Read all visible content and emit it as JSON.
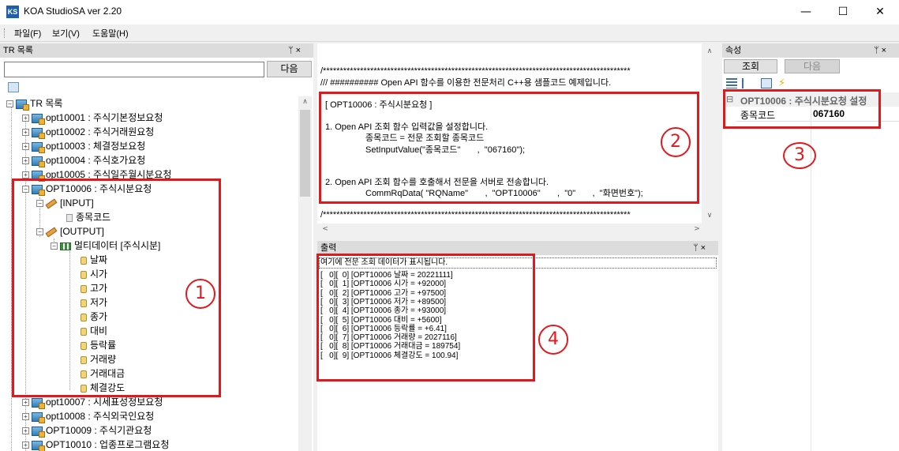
{
  "window": {
    "title": "KOA StudioSA ver 2.20",
    "icon_text": "KS",
    "minimize": "—",
    "maximize": "☐",
    "close": "✕"
  },
  "menu": [
    {
      "label": "파일(F)"
    },
    {
      "label": "보기(V)"
    },
    {
      "label": "도움말(H)"
    }
  ],
  "tr_panel": {
    "title": "TR 목록",
    "pin": "ᛘ ×",
    "search_value": "",
    "next_button": "다음",
    "root_label": "TR 목록",
    "items_top": [
      "opt10001 : 주식기본정보요청",
      "opt10002 : 주식거래원요청",
      "opt10003 : 체결정보요청",
      "opt10004 : 주식호가요청",
      "opt10005 : 주식일주월시분요청"
    ],
    "expanded": {
      "label": "OPT10006 : 주식시분요청",
      "input_label": "[INPUT]",
      "input_field": "종목코드",
      "output_label": "[OUTPUT]",
      "multi_label": "멀티데이터 [주식시분]",
      "fields": [
        "날짜",
        "시가",
        "고가",
        "저가",
        "종가",
        "대비",
        "등락률",
        "거래량",
        "거래대금",
        "체결강도"
      ]
    },
    "items_bottom": [
      "opt10007 : 시세표성정보요청",
      "opt10008 : 주식외국인요청",
      "OPT10009 : 주식기관요청",
      "OPT10010 : 업종프로그램요청"
    ]
  },
  "code_panel": {
    "stars_top": "/*******************************************************************************************",
    "comment": "/// ########## Open API 함수를 이용한 전문처리 C++용 샘플코드 예제입니다.",
    "header": "[ OPT10006 : 주식시분요청 ]",
    "step1": "1. Open API 조회 함수 입력값을 설정합니다.",
    "step1_sub": "종목코드 = 전문 조회할 종목코드",
    "step1_code": "SetInputValue(\"종목코드\"       ,  \"067160\");",
    "step2": "2. Open API 조회 함수를 호출해서 전문을 서버로 전송합니다.",
    "step2_code": "CommRqData( \"RQName\"       ,  \"OPT10006\"       ,  \"0\"       ,  \"화면번호\");",
    "stars_bottom": "/*******************************************************************************************",
    "scroll_left": "<",
    "scroll_right": ">",
    "scroll_up": "∧",
    "scroll_down": "∨"
  },
  "output_panel": {
    "title": "출력",
    "pin": "ᛘ ×",
    "header_line": "여기에 전문 조회 데이터가 표시됩니다.",
    "lines": [
      "[   0][  0] [OPT10006 날짜 = 20221111]",
      "[   0][  1] [OPT10006 시가 = +92000]",
      "[   0][  2] [OPT10006 고가 = +97500]",
      "[   0][  3] [OPT10006 저가 = +89500]",
      "[   0][  4] [OPT10006 종가 = +93000]",
      "[   0][  5] [OPT10006 대비 = +5600]",
      "[   0][  6] [OPT10006 등락률 = +6.41]",
      "[   0][  7] [OPT10006 거래량 = 2027116]",
      "[   0][  8] [OPT10006 거래대금 = 189754]",
      "[   0][  9] [OPT10006 체결강도 = 100.94]"
    ]
  },
  "props_panel": {
    "title": "속성",
    "pin": "ᛘ ×",
    "query_button": "조회",
    "next_button": "다음",
    "category": "OPT10006 : 주식시분요청 설정",
    "category_expander": "⊟",
    "field_name": "종목코드",
    "field_value": "067160"
  },
  "annotations": [
    "1",
    "2",
    "3",
    "4"
  ],
  "colors": {
    "annotation": "#e0191e",
    "panel_header": "#dcdcdc"
  }
}
